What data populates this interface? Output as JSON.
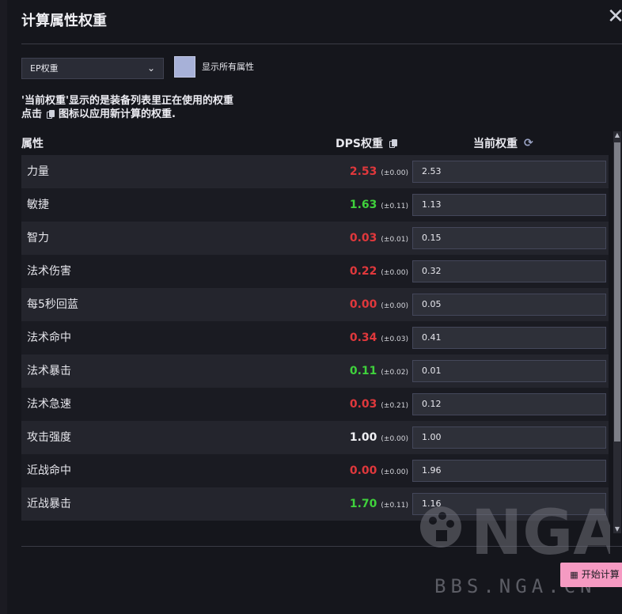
{
  "dialog": {
    "title": "计算属性权重",
    "close_icon": "close-icon"
  },
  "controls": {
    "select_value": "EP权重",
    "show_all_label": "显示所有属性"
  },
  "info": {
    "line1": "'当前权重'显示的是装备列表里正在使用的权重",
    "line2_prefix": "点击",
    "line2_suffix": "图标以应用新计算的权重."
  },
  "table": {
    "col_attr": "属性",
    "col_dps": "DPS权重",
    "col_current": "当前权重",
    "rows": [
      {
        "name": "力量",
        "dps": "2.53",
        "err": "(±0.00)",
        "current": "2.53",
        "color": "#e0383c"
      },
      {
        "name": "敏捷",
        "dps": "1.63",
        "err": "(±0.11)",
        "current": "1.13",
        "color": "#3fd13c"
      },
      {
        "name": "智力",
        "dps": "0.03",
        "err": "(±0.01)",
        "current": "0.15",
        "color": "#e0383c"
      },
      {
        "name": "法术伤害",
        "dps": "0.22",
        "err": "(±0.00)",
        "current": "0.32",
        "color": "#e0383c"
      },
      {
        "name": "每5秒回蓝",
        "dps": "0.00",
        "err": "(±0.00)",
        "current": "0.05",
        "color": "#e0383c"
      },
      {
        "name": "法术命中",
        "dps": "0.34",
        "err": "(±0.03)",
        "current": "0.41",
        "color": "#e0383c"
      },
      {
        "name": "法术暴击",
        "dps": "0.11",
        "err": "(±0.02)",
        "current": "0.01",
        "color": "#3fd13c"
      },
      {
        "name": "法术急速",
        "dps": "0.03",
        "err": "(±0.21)",
        "current": "0.12",
        "color": "#e0383c"
      },
      {
        "name": "攻击强度",
        "dps": "1.00",
        "err": "(±0.00)",
        "current": "1.00",
        "color": "#f0f0f4"
      },
      {
        "name": "近战命中",
        "dps": "0.00",
        "err": "(±0.00)",
        "current": "1.96",
        "color": "#e0383c"
      },
      {
        "name": "近战暴击",
        "dps": "1.70",
        "err": "(±0.11)",
        "current": "1.16",
        "color": "#3fd13c"
      }
    ]
  },
  "footer": {
    "start_label": "开始计算",
    "watermark_logo": "NGA",
    "watermark_text": "BBS.NGA.CN"
  }
}
